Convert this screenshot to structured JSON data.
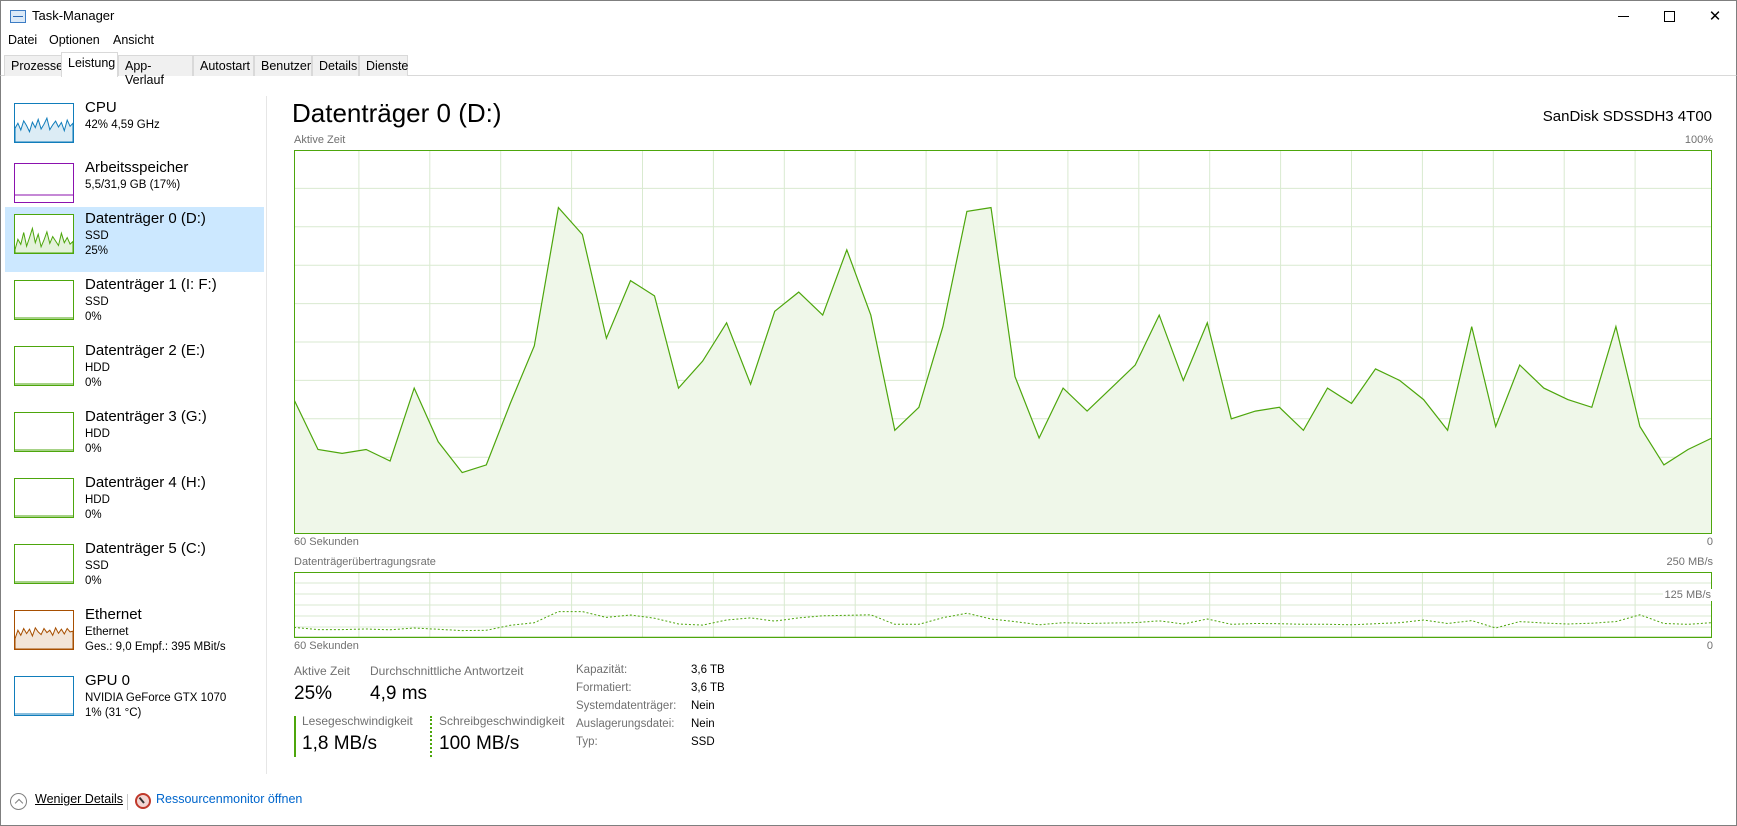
{
  "window": {
    "title": "Task-Manager",
    "minimize_glyph": "",
    "maximize_glyph": "",
    "close_glyph": "✕"
  },
  "menu": [
    "Datei",
    "Optionen",
    "Ansicht"
  ],
  "tabs": [
    "Prozesse",
    "Leistung",
    "App-Verlauf",
    "Autostart",
    "Benutzer",
    "Details",
    "Dienste"
  ],
  "active_tab": "Leistung",
  "sidebar": {
    "items": [
      {
        "name": "CPU",
        "line1": "42%  4,59 GHz",
        "line2": "",
        "icon": "cpu-graph-icon",
        "color": "#117dbb",
        "selected": false
      },
      {
        "name": "Arbeitsspeicher",
        "line1": "5,5/31,9 GB (17%)",
        "line2": "",
        "icon": "memory-graph-icon",
        "color": "#8b12ae",
        "selected": false
      },
      {
        "name": "Datenträger 0 (D:)",
        "line1": "SSD",
        "line2": "25%",
        "icon": "disk-graph-icon",
        "color": "#4da60c",
        "selected": true
      },
      {
        "name": "Datenträger 1 (I: F:)",
        "line1": "SSD",
        "line2": "0%",
        "icon": "disk-graph-icon",
        "color": "#4da60c",
        "selected": false
      },
      {
        "name": "Datenträger 2 (E:)",
        "line1": "HDD",
        "line2": "0%",
        "icon": "disk-graph-icon",
        "color": "#4da60c",
        "selected": false
      },
      {
        "name": "Datenträger 3 (G:)",
        "line1": "HDD",
        "line2": "0%",
        "icon": "disk-graph-icon",
        "color": "#4da60c",
        "selected": false
      },
      {
        "name": "Datenträger 4 (H:)",
        "line1": "HDD",
        "line2": "0%",
        "icon": "disk-graph-icon",
        "color": "#4da60c",
        "selected": false
      },
      {
        "name": "Datenträger 5 (C:)",
        "line1": "SSD",
        "line2": "0%",
        "icon": "disk-graph-icon",
        "color": "#4da60c",
        "selected": false
      },
      {
        "name": "Ethernet",
        "line1": "Ethernet",
        "line2": "Ges.: 9,0 Empf.: 395 MBit/s",
        "icon": "network-graph-icon",
        "color": "#a74f01",
        "selected": false
      },
      {
        "name": "GPU 0",
        "line1": "NVIDIA GeForce GTX 1070",
        "line2": "1% (31 °C)",
        "icon": "gpu-graph-icon",
        "color": "#117dbb",
        "selected": false
      }
    ]
  },
  "main": {
    "title": "Datenträger 0 (D:)",
    "device": "SanDisk SDSSDH3 4T00",
    "graph1": {
      "label_top_left": "Aktive Zeit",
      "label_top_right": "100%",
      "label_bottom_left": "60 Sekunden",
      "label_bottom_right": "0"
    },
    "graph2": {
      "label_top_left": "Datenträgerübertragungsrate",
      "label_top_right": "250 MB/s",
      "label_mid_right": "125 MB/s",
      "label_bottom_left": "60 Sekunden",
      "label_bottom_right": "0"
    },
    "stats": {
      "active_time_label": "Aktive Zeit",
      "active_time_value": "25%",
      "response_label": "Durchschnittliche Antwortzeit",
      "response_value": "4,9 ms",
      "read_label": "Lesegeschwindigkeit",
      "read_value": "1,8 MB/s",
      "write_label": "Schreibgeschwindigkeit",
      "write_value": "100 MB/s"
    },
    "properties": [
      {
        "label": "Kapazität:",
        "value": "3,6 TB"
      },
      {
        "label": "Formatiert:",
        "value": "3,6 TB"
      },
      {
        "label": "Systemdatenträger:",
        "value": "Nein"
      },
      {
        "label": "Auslagerungsdatei:",
        "value": "Nein"
      },
      {
        "label": "Typ:",
        "value": "SSD"
      }
    ]
  },
  "footer": {
    "less_details": "Weniger Details",
    "resource_monitor": "Ressourcenmonitor öffnen"
  },
  "colors": {
    "disk_line": "#4da60c",
    "disk_fill": "#eff7e9",
    "grid": "#d9ead0",
    "selected_bg": "#cce8ff",
    "link": "#0066cc"
  },
  "chart_data": [
    {
      "type": "area",
      "series": [
        {
          "values": [
            35,
            22,
            21,
            22,
            19,
            38,
            24,
            16,
            18,
            34,
            49,
            85,
            78,
            51,
            66,
            62,
            38,
            45,
            55,
            39,
            58,
            63,
            57,
            74,
            57,
            27,
            33,
            54,
            84,
            85,
            41,
            25,
            38,
            32,
            38,
            44,
            57,
            40,
            55,
            30,
            32,
            33,
            27,
            38,
            34,
            43,
            40,
            35,
            27,
            54,
            28,
            44,
            38,
            35,
            33,
            54,
            28,
            18,
            22,
            25
          ]
        }
      ],
      "ylim": [
        0,
        100
      ]
    },
    {
      "type": "line",
      "series": [
        {
          "values": [
            40,
            32,
            32,
            34,
            31,
            38,
            33,
            28,
            29,
            48,
            58,
            100,
            100,
            78,
            87,
            75,
            53,
            49,
            68,
            76,
            64,
            76,
            84,
            86,
            88,
            52,
            52,
            77,
            94,
            72,
            62,
            50,
            58,
            55,
            57,
            58,
            65,
            53,
            72,
            52,
            55,
            54,
            52,
            52,
            50,
            54,
            58,
            68,
            55,
            66,
            38,
            62,
            57,
            53,
            56,
            62,
            88,
            55,
            52,
            58
          ]
        },
        {
          "values": [
            0.7,
            0.7,
            0.7,
            0.7,
            0.7,
            0.7,
            0.7,
            0.7,
            0.7,
            0.7,
            0.7,
            0.7,
            0.7,
            0.7,
            0.7,
            0.7,
            0.7,
            0.7,
            0.7,
            0.7,
            0.7,
            0.7,
            0.7,
            0.7,
            0.7,
            0.7,
            0.7,
            0.7,
            0.7,
            0.7,
            0.7,
            0.7,
            0.7,
            0.7,
            0.7,
            0.7,
            0.7,
            0.7,
            0.7,
            0.7,
            0.7,
            0.7,
            0.7,
            0.7,
            0.7,
            0.7,
            0.7,
            0.7,
            0.7,
            0.7,
            0.7,
            0.7,
            0.7,
            0.7,
            0.7,
            0.7,
            0.7,
            0.7,
            0.7,
            0.7
          ]
        }
      ],
      "ylim": [
        0,
        250
      ]
    }
  ]
}
